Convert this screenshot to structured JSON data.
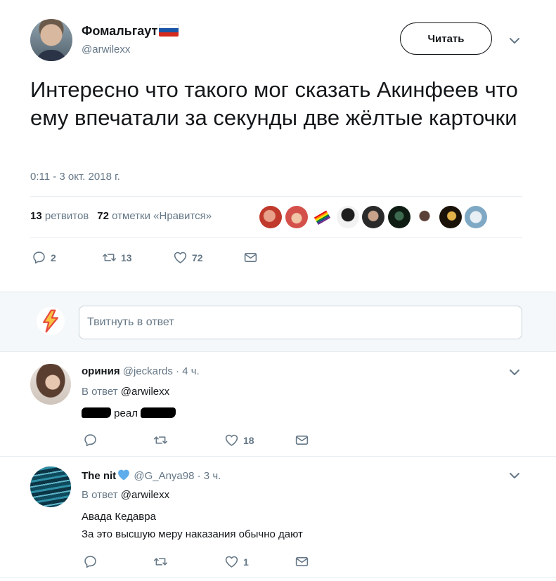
{
  "tweet": {
    "display_name": "Фомальгаут",
    "handle": "@arwilexx",
    "follow_label": "Читать",
    "text": "Интересно что такого мог сказать Акинфеев что ему впечатали за секунды две жёлтые карточки",
    "time": "0:11 - 3 окт. 2018 г.",
    "retweet_count": "13",
    "retweet_label": "ретвитов",
    "like_count": "72",
    "like_label": "отметки «Нравится»",
    "actions": {
      "replies": "2",
      "retweets": "13",
      "likes": "72"
    }
  },
  "composer": {
    "placeholder": "Твитнуть в ответ"
  },
  "replies": [
    {
      "name": "ориния",
      "handle": "@jeckards",
      "time": "· 4 ч.",
      "in_reply_prefix": "В ответ",
      "in_reply_to": "@arwilexx",
      "text": "реал",
      "actions": {
        "replies": "",
        "retweets": "",
        "likes": "18"
      }
    },
    {
      "name": "The nit",
      "handle": "@G_Anya98",
      "time": "· 3 ч.",
      "in_reply_prefix": "В ответ",
      "in_reply_to": "@arwilexx",
      "text_line1": "Авада Кедавра",
      "text_line2": "За это высшую меру наказания обычно дают",
      "actions": {
        "replies": "",
        "retweets": "",
        "likes": "1"
      }
    }
  ],
  "colors": {
    "text": "#14171a",
    "secondary": "#657786",
    "divider": "#e6ecf0",
    "composer_bg": "#f5f8fa",
    "heart_emoji": "#5dadec"
  },
  "icons": {
    "flag": "russia-flag-icon",
    "reply": "reply-icon",
    "retweet": "retweet-icon",
    "like": "heart-icon",
    "dm": "envelope-icon",
    "menu": "chevron-down-icon"
  }
}
